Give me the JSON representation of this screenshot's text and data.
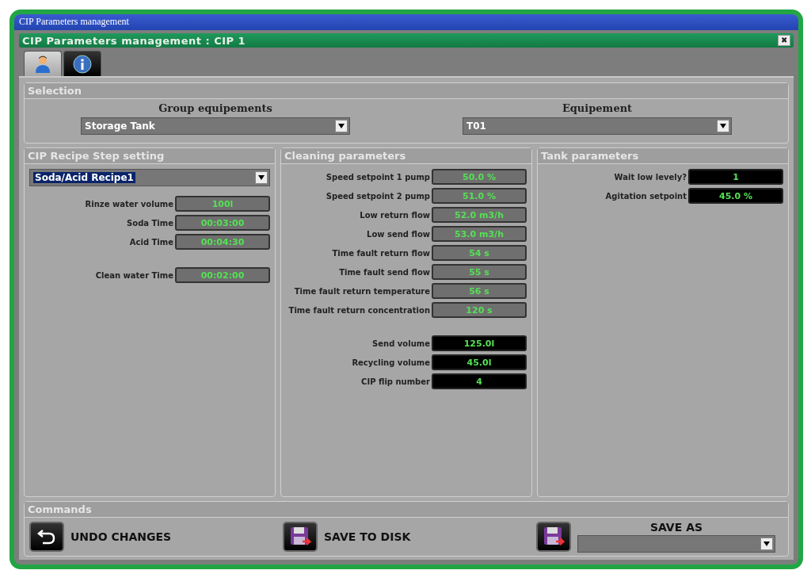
{
  "window": {
    "title": "CIP Parameters management"
  },
  "dialog": {
    "title": "CIP Parameters management : CIP 1",
    "close": "✖"
  },
  "tabs": [
    {
      "kind": "user",
      "selected": true
    },
    {
      "kind": "info",
      "selected": false
    }
  ],
  "selection": {
    "title": "Selection",
    "fields": [
      {
        "label": "Group equipements",
        "value": "Storage Tank"
      },
      {
        "label": "Equipement",
        "value": "T01"
      }
    ]
  },
  "recipe": {
    "title": "CIP Recipe Step setting",
    "value": "Soda/Acid Recipe1",
    "groups": [
      {
        "rows": [
          {
            "label": "Rinze water volume",
            "value": "100l",
            "kind": "input"
          },
          {
            "label": "Soda Time",
            "value": "00:03:00",
            "kind": "input"
          },
          {
            "label": "Acid Time",
            "value": "00:04:30",
            "kind": "input"
          }
        ]
      },
      {
        "rows": [
          {
            "label": "Clean water Time",
            "value": "00:02:00",
            "kind": "input"
          }
        ]
      }
    ]
  },
  "cleaning": {
    "title": "Cleaning parameters",
    "groups": [
      {
        "rows": [
          {
            "label": "Speed setpoint 1 pump",
            "value": "50.0 %",
            "kind": "input"
          },
          {
            "label": "Speed setpoint 2 pump",
            "value": "51.0 %",
            "kind": "input"
          },
          {
            "label": "Low return flow",
            "value": "52.0 m3/h",
            "kind": "input"
          },
          {
            "label": "Low send flow",
            "value": "53.0 m3/h",
            "kind": "input"
          },
          {
            "label": "Time fault return flow",
            "value": "54 s",
            "kind": "input"
          },
          {
            "label": "Time fault send flow",
            "value": "55 s",
            "kind": "input"
          },
          {
            "label": "Time fault return temperature",
            "value": "56 s",
            "kind": "input"
          },
          {
            "label": "Time fault return concentration",
            "value": "120 s",
            "kind": "input"
          }
        ]
      },
      {
        "rows": [
          {
            "label": "Send volume",
            "value": "125.0l",
            "kind": "display"
          },
          {
            "label": "Recycling volume",
            "value": "45.0l",
            "kind": "display"
          },
          {
            "label": "CIP flip number",
            "value": "4",
            "kind": "display"
          }
        ]
      }
    ]
  },
  "tank": {
    "title": "Tank parameters",
    "groups": [
      {
        "rows": [
          {
            "label": "Wait low levely?",
            "value": "1",
            "kind": "display"
          },
          {
            "label": "Agitation setpoint",
            "value": "45.0 %",
            "kind": "display"
          }
        ]
      }
    ]
  },
  "commands": {
    "title": "Commands",
    "buttons": [
      {
        "kind": "undo",
        "label": "UNDO CHANGES"
      },
      {
        "kind": "save",
        "label": "SAVE TO DISK"
      }
    ],
    "save_as": {
      "kind": "save",
      "label": "SAVE AS"
    }
  }
}
